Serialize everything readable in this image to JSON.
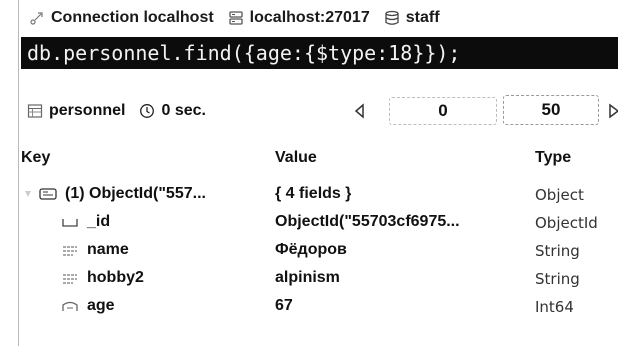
{
  "connection": {
    "name": "Connection localhost",
    "server": "localhost:27017",
    "database": "staff"
  },
  "query": {
    "text": "db.personnel.find({age:{$type:18}});"
  },
  "toolbar": {
    "collection": "personnel",
    "time": "0 sec.",
    "skip": "0",
    "limit": "50"
  },
  "table": {
    "headers": {
      "key": "Key",
      "value": "Value",
      "type": "Type"
    },
    "rows": [
      {
        "key": "(1) ObjectId(\"557...",
        "value": "{ 4 fields }",
        "type": "Object",
        "icon": "document-icon"
      },
      {
        "key": "_id",
        "value": "ObjectId(\"55703cf6975...",
        "type": "ObjectId",
        "icon": "id-field-icon"
      },
      {
        "key": "name",
        "value": "Фёдоров",
        "type": "String",
        "icon": "string-field-icon"
      },
      {
        "key": "hobby2",
        "value": "alpinism",
        "type": "String",
        "icon": "string-field-icon"
      },
      {
        "key": "age",
        "value": "67",
        "type": "Int64",
        "icon": "number-field-icon"
      }
    ]
  }
}
